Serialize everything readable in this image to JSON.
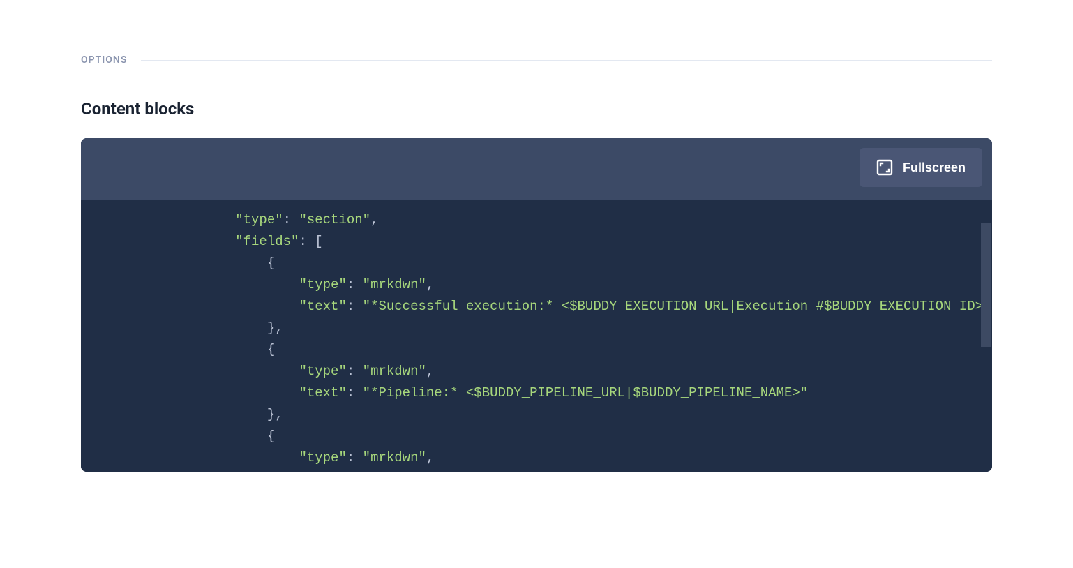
{
  "section": {
    "label": "OPTIONS",
    "title": "Content blocks"
  },
  "toolbar": {
    "fullscreen_label": "Fullscreen"
  },
  "code": {
    "lines": [
      {
        "indent": 2,
        "tokens": [
          {
            "t": "str",
            "v": "\"type\""
          },
          {
            "t": "punc",
            "v": ": "
          },
          {
            "t": "str",
            "v": "\"section\""
          },
          {
            "t": "punc",
            "v": ","
          }
        ]
      },
      {
        "indent": 2,
        "tokens": [
          {
            "t": "str",
            "v": "\"fields\""
          },
          {
            "t": "punc",
            "v": ": ["
          }
        ]
      },
      {
        "indent": 3,
        "tokens": [
          {
            "t": "punc",
            "v": "{"
          }
        ]
      },
      {
        "indent": 4,
        "tokens": [
          {
            "t": "str",
            "v": "\"type\""
          },
          {
            "t": "punc",
            "v": ": "
          },
          {
            "t": "str",
            "v": "\"mrkdwn\""
          },
          {
            "t": "punc",
            "v": ","
          }
        ]
      },
      {
        "indent": 4,
        "tokens": [
          {
            "t": "str",
            "v": "\"text\""
          },
          {
            "t": "punc",
            "v": ": "
          },
          {
            "t": "str",
            "v": "\"*Successful execution:* <$BUDDY_EXECUTION_URL|Execution #$BUDDY_EXECUTION_ID>\""
          }
        ]
      },
      {
        "indent": 3,
        "tokens": [
          {
            "t": "punc",
            "v": "},"
          }
        ]
      },
      {
        "indent": 3,
        "tokens": [
          {
            "t": "punc",
            "v": "{"
          }
        ]
      },
      {
        "indent": 4,
        "tokens": [
          {
            "t": "str",
            "v": "\"type\""
          },
          {
            "t": "punc",
            "v": ": "
          },
          {
            "t": "str",
            "v": "\"mrkdwn\""
          },
          {
            "t": "punc",
            "v": ","
          }
        ]
      },
      {
        "indent": 4,
        "tokens": [
          {
            "t": "str",
            "v": "\"text\""
          },
          {
            "t": "punc",
            "v": ": "
          },
          {
            "t": "str",
            "v": "\"*Pipeline:* <$BUDDY_PIPELINE_URL|$BUDDY_PIPELINE_NAME>\""
          }
        ]
      },
      {
        "indent": 3,
        "tokens": [
          {
            "t": "punc",
            "v": "},"
          }
        ]
      },
      {
        "indent": 3,
        "tokens": [
          {
            "t": "punc",
            "v": "{"
          }
        ]
      },
      {
        "indent": 4,
        "tokens": [
          {
            "t": "str",
            "v": "\"type\""
          },
          {
            "t": "punc",
            "v": ": "
          },
          {
            "t": "str",
            "v": "\"mrkdwn\""
          },
          {
            "t": "punc",
            "v": ","
          }
        ]
      }
    ]
  }
}
